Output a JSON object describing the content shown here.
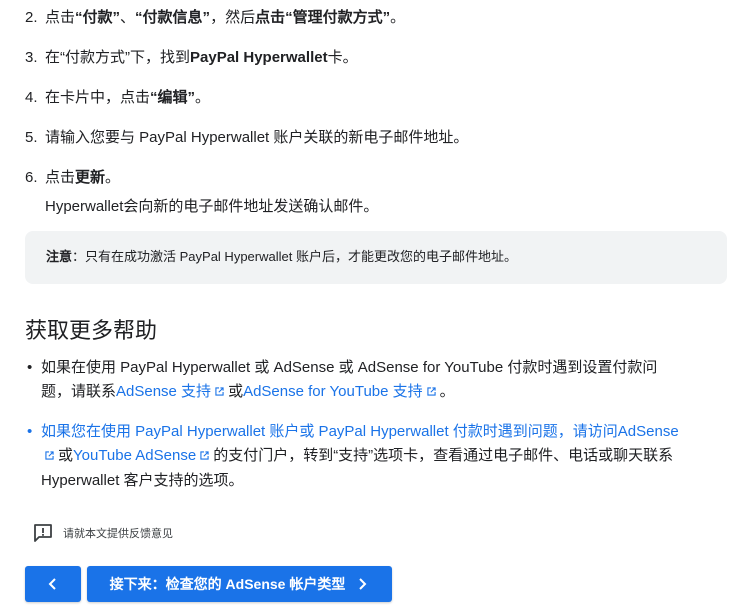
{
  "steps": {
    "s2": {
      "num": "2.",
      "a": "点击",
      "b1": "“付款”",
      "c": "、",
      "b2": "“付款信息”",
      "d": "，然后",
      "b3": "点击“管理付款方式”",
      "e": "。"
    },
    "s3": {
      "num": "3.",
      "a": "在“付款方式”下，找到",
      "b": "PayPal Hyperwallet",
      "c": "卡。"
    },
    "s4": {
      "num": "4.",
      "a": "在卡片中，点击",
      "b": "“编辑”",
      "c": "。"
    },
    "s5": {
      "num": "5.",
      "a": "请输入您要与 PayPal Hyperwallet 账户关联的新电子邮件地址。"
    },
    "s6": {
      "num": "6.",
      "a": "点击",
      "b": "更新",
      "c": "。",
      "sub": "Hyperwallet会向新的电子邮件地址发送确认邮件。"
    }
  },
  "note": {
    "label": "注意",
    "text": "：只有在成功激活 PayPal Hyperwallet 账户后，才能更改您的电子邮件地址。"
  },
  "help": {
    "title": "获取更多帮助",
    "b1": {
      "line1": "如果在使用 PayPal Hyperwallet 或 AdSense 或 AdSense for YouTube 付款时遇到设置付款问",
      "line2a": "题，请联系",
      "link1": "AdSense 支持",
      "or": "或",
      "link2": "AdSense for YouTube 支持",
      "end": "。"
    },
    "b2": {
      "link1": "如果您在使用 PayPal Hyperwallet 账户或 PayPal Hyperwallet 付款时遇到问题，请访问AdSense",
      "or": "或",
      "link2": "YouTube AdSense",
      "tail1": "的支付门户，转到“支持”选项卡，查看通过电子邮件、电话或聊天联系",
      "tail2": "Hyperwallet 客户支持的选项。"
    }
  },
  "feedback": {
    "label": "请就本文提供反馈意见",
    "icon": "feedback-icon"
  },
  "nav": {
    "prev_icon": "chevron-left-icon",
    "next_label": "接下来：检查您的 AdSense 帐户类型",
    "next_icon": "chevron-right-icon"
  },
  "colors": {
    "accent": "#1a73e8",
    "note_bg": "#f1f3f4",
    "text": "#202124"
  }
}
